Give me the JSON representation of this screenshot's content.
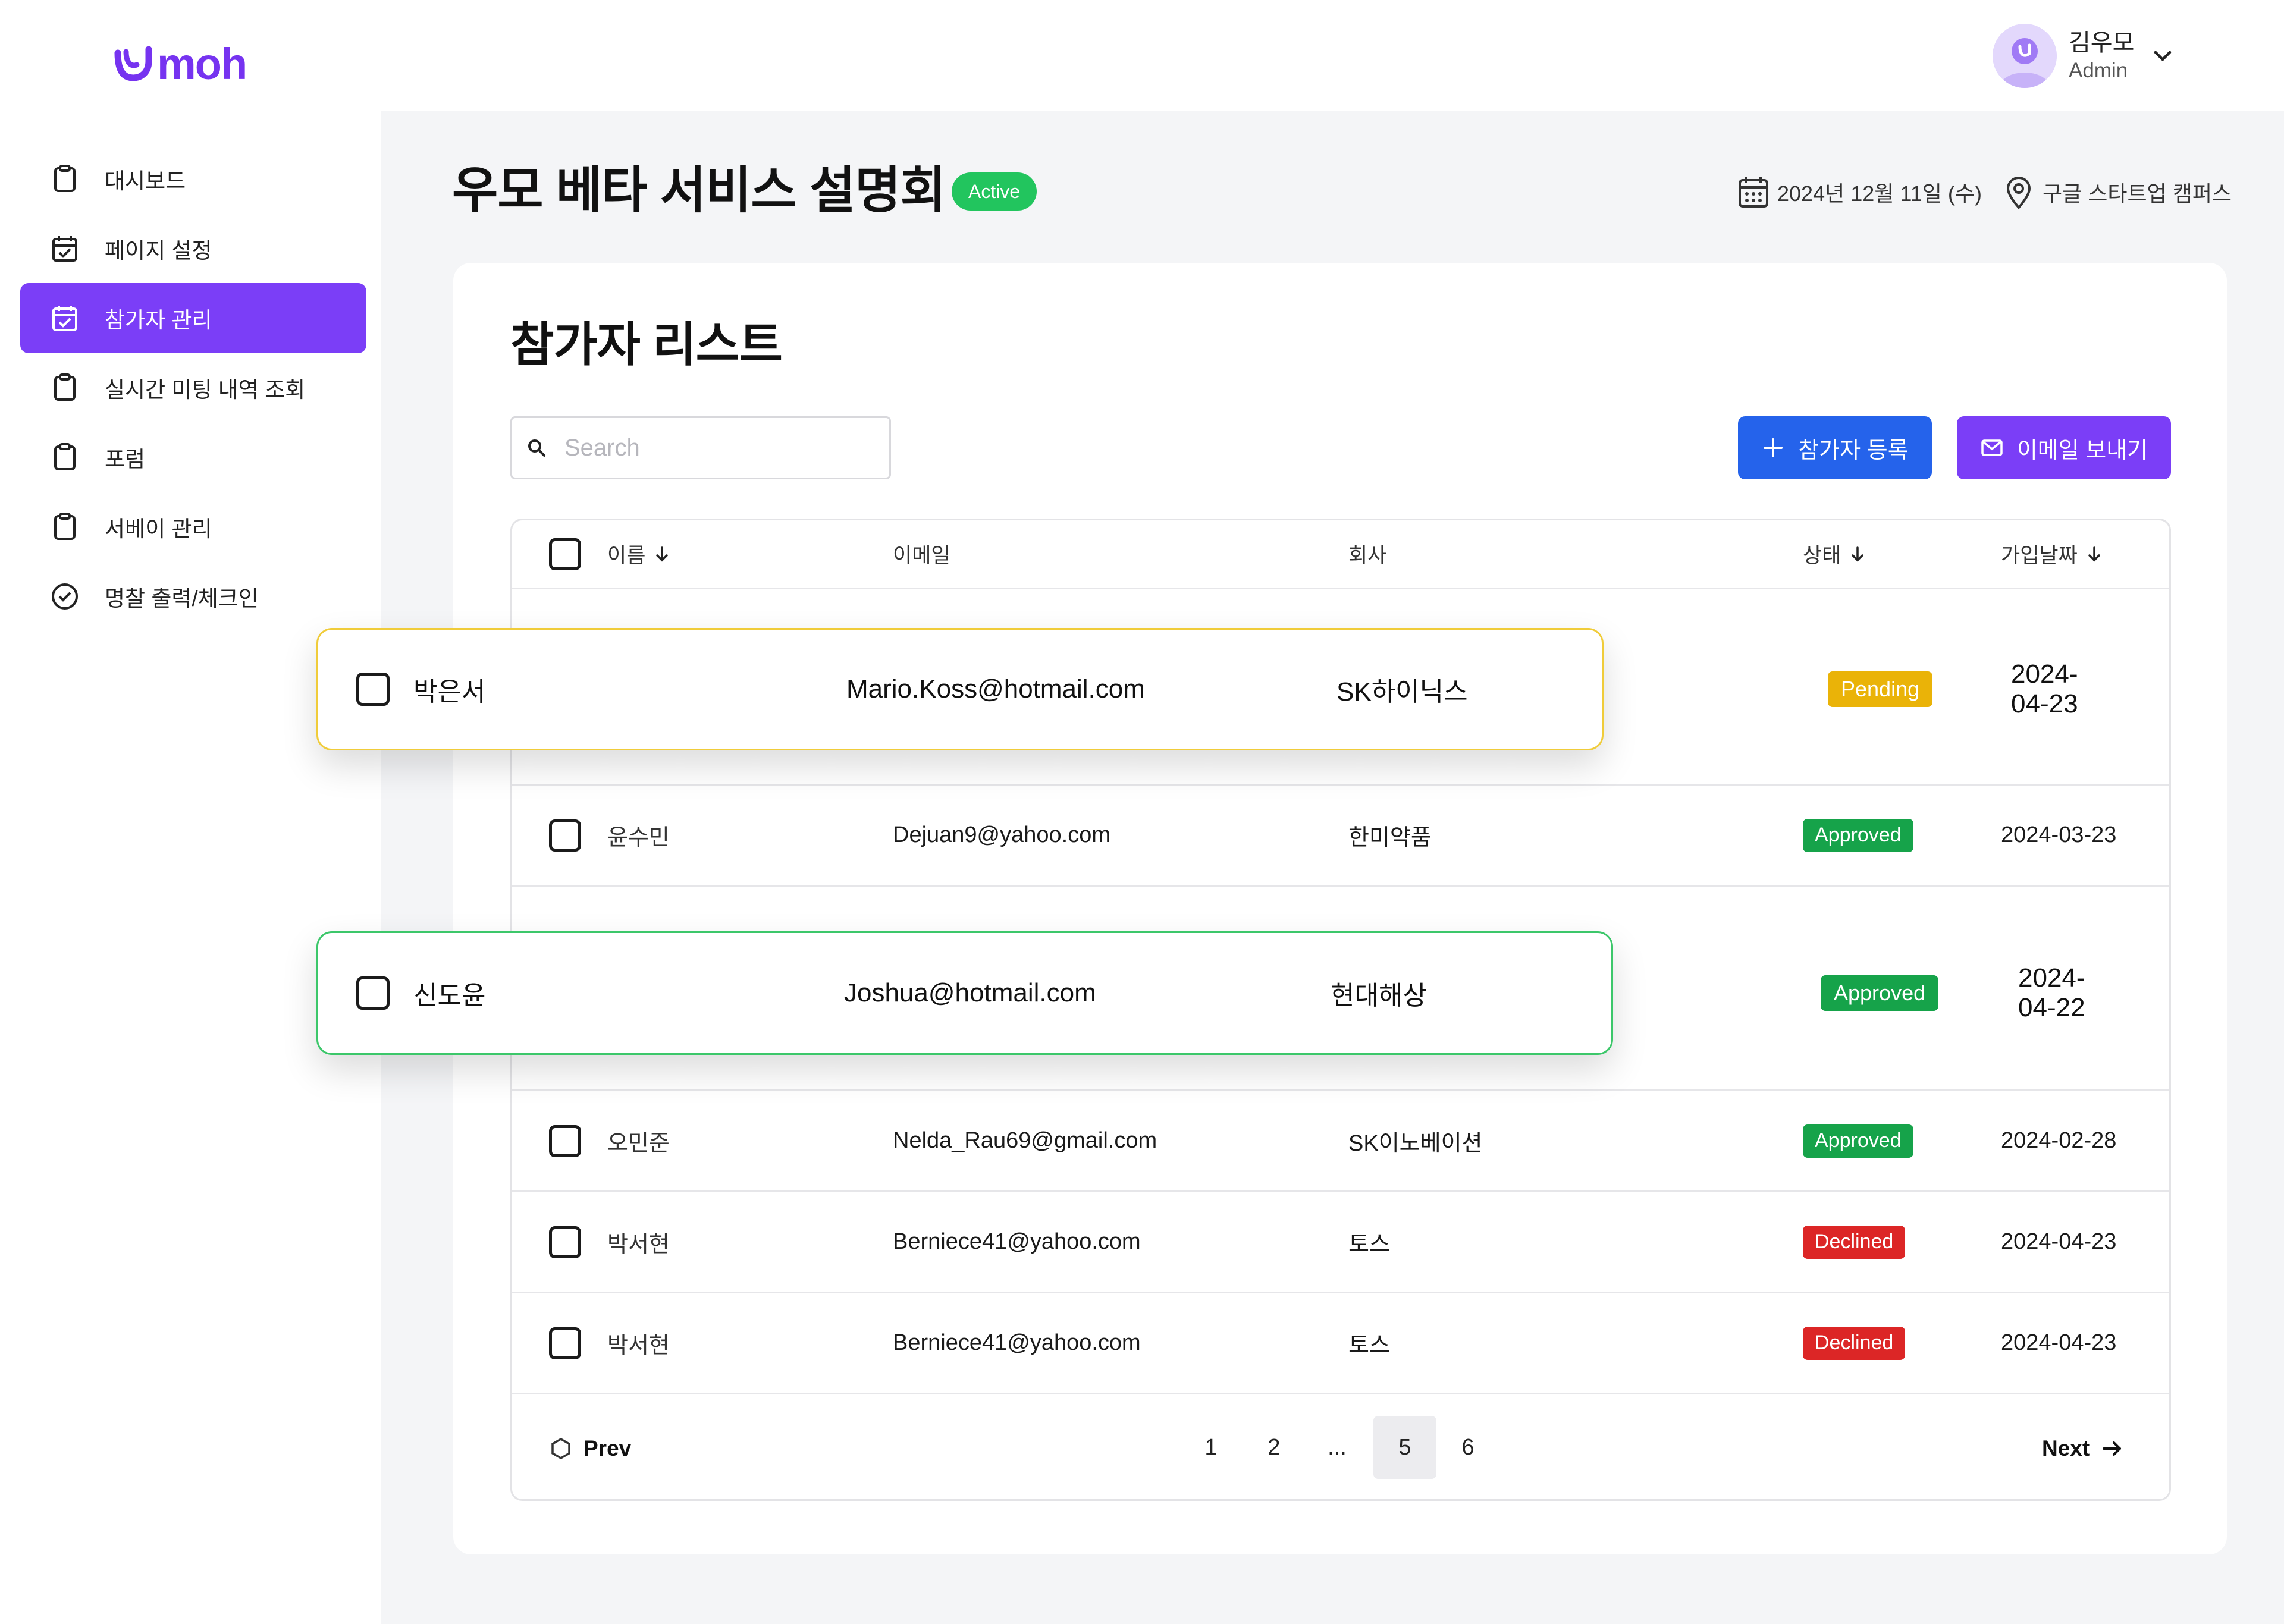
{
  "brand": {
    "name": "moh",
    "color": "#7633f0"
  },
  "user": {
    "name": "김우모",
    "role": "Admin"
  },
  "sidebar": {
    "items": [
      {
        "label": "대시보드",
        "icon": "clipboard-icon",
        "active": false
      },
      {
        "label": "페이지 설정",
        "icon": "calendar-check-icon",
        "active": false
      },
      {
        "label": "참가자 관리",
        "icon": "calendar-check-icon",
        "active": true
      },
      {
        "label": "실시간 미팅 내역 조회",
        "icon": "clipboard-icon",
        "active": false
      },
      {
        "label": "포럼",
        "icon": "clipboard-icon",
        "active": false
      },
      {
        "label": "서베이 관리",
        "icon": "clipboard-icon",
        "active": false
      },
      {
        "label": "명찰 출력/체크인",
        "icon": "check-circle-icon",
        "active": false
      }
    ]
  },
  "event": {
    "title": "우모 베타 서비스 설명회",
    "status": "Active",
    "date": "2024년 12월 11일 (수)",
    "location": "구글 스타트업 캠퍼스"
  },
  "participants": {
    "title": "참가자 리스트",
    "search_placeholder": "Search",
    "add_button": "참가자 등록",
    "email_button": "이메일 보내기",
    "columns": {
      "name": "이름",
      "email": "이메일",
      "company": "회사",
      "status": "상태",
      "joined": "가입날짜"
    },
    "rows": [
      {
        "name": "윤수민",
        "email": "Dejuan9@yahoo.com",
        "company": "한미약품",
        "status": "Approved",
        "date": "2024-03-23"
      },
      {
        "name": "오민준",
        "email": "Nelda_Rau69@gmail.com",
        "company": "SK이노베이션",
        "status": "Approved",
        "date": "2024-02-28"
      },
      {
        "name": "박서현",
        "email": "Berniece41@yahoo.com",
        "company": "토스",
        "status": "Declined",
        "date": "2024-04-23"
      },
      {
        "name": "박서현",
        "email": "Berniece41@yahoo.com",
        "company": "토스",
        "status": "Declined",
        "date": "2024-04-23"
      }
    ],
    "highlighted": [
      {
        "name": "박은서",
        "email": "Mario.Koss@hotmail.com",
        "company": "SK하이닉스",
        "status": "Pending",
        "date": "2024-04-23"
      },
      {
        "name": "신도윤",
        "email": "Joshua@hotmail.com",
        "company": "현대해상",
        "status": "Approved",
        "date": "2024-04-22"
      }
    ],
    "pagination": {
      "prev": "Prev",
      "next": "Next",
      "pages": [
        "1",
        "2",
        "...",
        "5",
        "6"
      ],
      "current": "5"
    }
  },
  "colors": {
    "accent": "#7b3ef7",
    "primary_blue": "#2563eb",
    "approved": "#16a34a",
    "pending": "#eab308",
    "declined": "#dc2626",
    "active": "#22c55e"
  }
}
